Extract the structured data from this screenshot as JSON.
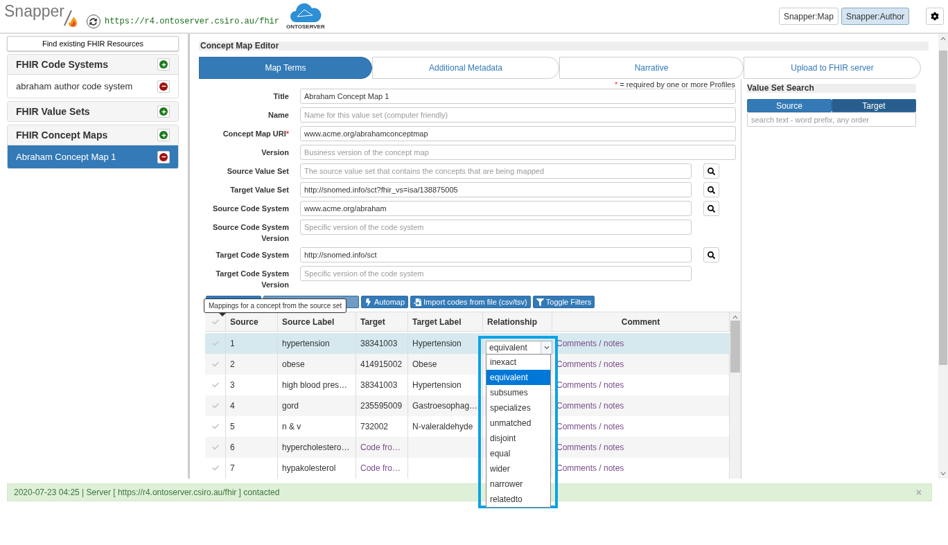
{
  "header": {
    "logo": "Snapper",
    "server_url": "https://r4.ontoserver.csiro.au/fhir",
    "server_logo": "ONTOSERVER",
    "modes": [
      {
        "label": "Snapper:Map",
        "selected": false
      },
      {
        "label": "Snapper:Author",
        "selected": true
      }
    ]
  },
  "sidebar": {
    "find_button": "Find existing FHIR Resources",
    "sections": [
      {
        "title": "FHIR Code Systems",
        "items": [
          {
            "label": "abraham author code system",
            "selected": false
          }
        ]
      },
      {
        "title": "FHIR Value Sets"
      },
      {
        "title": "FHIR Concept Maps",
        "items": [
          {
            "label": "Abraham Concept Map 1",
            "selected": true
          }
        ]
      }
    ]
  },
  "editor": {
    "title": "Concept Map Editor",
    "tabs": [
      {
        "label": "Map Terms",
        "selected": true
      },
      {
        "label": "Additional Metadata",
        "selected": false
      },
      {
        "label": "Narrative",
        "selected": false
      },
      {
        "label": "Upload to FHIR server",
        "selected": false
      }
    ],
    "required_note": "= required by one or more Profiles",
    "required_mark": "*",
    "fields": [
      {
        "label": "Title",
        "value": "Abraham Concept Map 1",
        "required": false,
        "search": false,
        "wide": true
      },
      {
        "label": "Name",
        "placeholder": "Name for this value set (computer friendly)",
        "required": false,
        "search": false,
        "wide": true
      },
      {
        "label": "Concept Map URI",
        "value": "www.acme.org/abrahamconceptmap",
        "required": true,
        "search": false,
        "wide": true
      },
      {
        "label": "Version",
        "placeholder": "Business version of the concept map",
        "required": false,
        "search": false,
        "wide": true
      },
      {
        "label": "Source Value Set",
        "placeholder": "The source value set that contains the concepts that are being mapped",
        "required": false,
        "search": true,
        "wide": false
      },
      {
        "label": "Target Value Set",
        "value": "http://snomed.info/sct?fhir_vs=isa/138875005",
        "required": false,
        "search": true,
        "wide": false
      },
      {
        "label": "Source Code System",
        "value": "www.acme.org/abraham",
        "required": false,
        "search": true,
        "wide": false
      },
      {
        "label": "Source Code System Version",
        "placeholder": "Specific version of the code system",
        "required": false,
        "search": false,
        "wide": false
      },
      {
        "label": "Target Code System",
        "value": "http://snomed.info/sct",
        "required": false,
        "search": true,
        "wide": false
      },
      {
        "label": "Target Code System Version",
        "placeholder": "Specific version of the code system",
        "required": false,
        "search": false,
        "wide": false
      }
    ],
    "toolbar": [
      {
        "label": "Automap",
        "kind": "bolt"
      },
      {
        "label": "Import codes from file (csv/tsv)",
        "kind": "import"
      },
      {
        "label": "Toggle Filters",
        "kind": "filter"
      }
    ],
    "tooltip": "Mappings for a concept from the source set",
    "table": {
      "columns": [
        "Source",
        "Source Label",
        "Target",
        "Target Label",
        "Relationship",
        "Comment"
      ],
      "rows": [
        {
          "source": "1",
          "source_label": "hypertension",
          "target": "38341003",
          "target_found": true,
          "target_label": "Hypertension",
          "comment": "Comments / notes",
          "selected": true
        },
        {
          "source": "2",
          "source_label": "obese",
          "target": "414915002",
          "target_found": true,
          "target_label": "Obese",
          "comment": "Comments / notes",
          "selected": false
        },
        {
          "source": "3",
          "source_label": "high blood pres…",
          "target": "38341003",
          "target_found": true,
          "target_label": "Hypertension",
          "comment": "Comments / notes",
          "selected": false
        },
        {
          "source": "4",
          "source_label": "gord",
          "target": "235595009",
          "target_found": true,
          "target_label": "Gastroesophag…",
          "comment": "Comments / notes",
          "selected": false
        },
        {
          "source": "5",
          "source_label": "n & v",
          "target": "732002",
          "target_found": true,
          "target_label": "N-valeraldehyde",
          "comment": "Comments / notes",
          "selected": false
        },
        {
          "source": "6",
          "source_label": "hypercholestero…",
          "target": "Code fro…",
          "target_found": false,
          "comment": "Comments / notes",
          "selected": false
        },
        {
          "source": "7",
          "source_label": "hypakolesterol",
          "target": "Code fro…",
          "target_found": false,
          "comment": "Comments / notes",
          "selected": false
        }
      ]
    },
    "relationship_select": {
      "value": "equivalent",
      "options": [
        {
          "label": "inexact",
          "selected": false
        },
        {
          "label": "equivalent",
          "selected": true
        },
        {
          "label": "subsumes",
          "selected": false
        },
        {
          "label": "specializes",
          "selected": false
        },
        {
          "label": "unmatched",
          "selected": false
        },
        {
          "label": "disjoint",
          "selected": false
        },
        {
          "label": "equal",
          "selected": false
        },
        {
          "label": "wider",
          "selected": false
        },
        {
          "label": "narrower",
          "selected": false
        },
        {
          "label": "relatedto",
          "selected": false
        }
      ]
    }
  },
  "value_set_search": {
    "title": "Value Set Search",
    "tabs": [
      {
        "label": "Source",
        "selected": false
      },
      {
        "label": "Target",
        "selected": true
      }
    ],
    "placeholder": "search text - word prefix, any order"
  },
  "status": {
    "message": "2020-07-23 04:25 | Server [ https://r4.ontoserver.csiro.au/fhir ] contacted",
    "close": "×"
  }
}
